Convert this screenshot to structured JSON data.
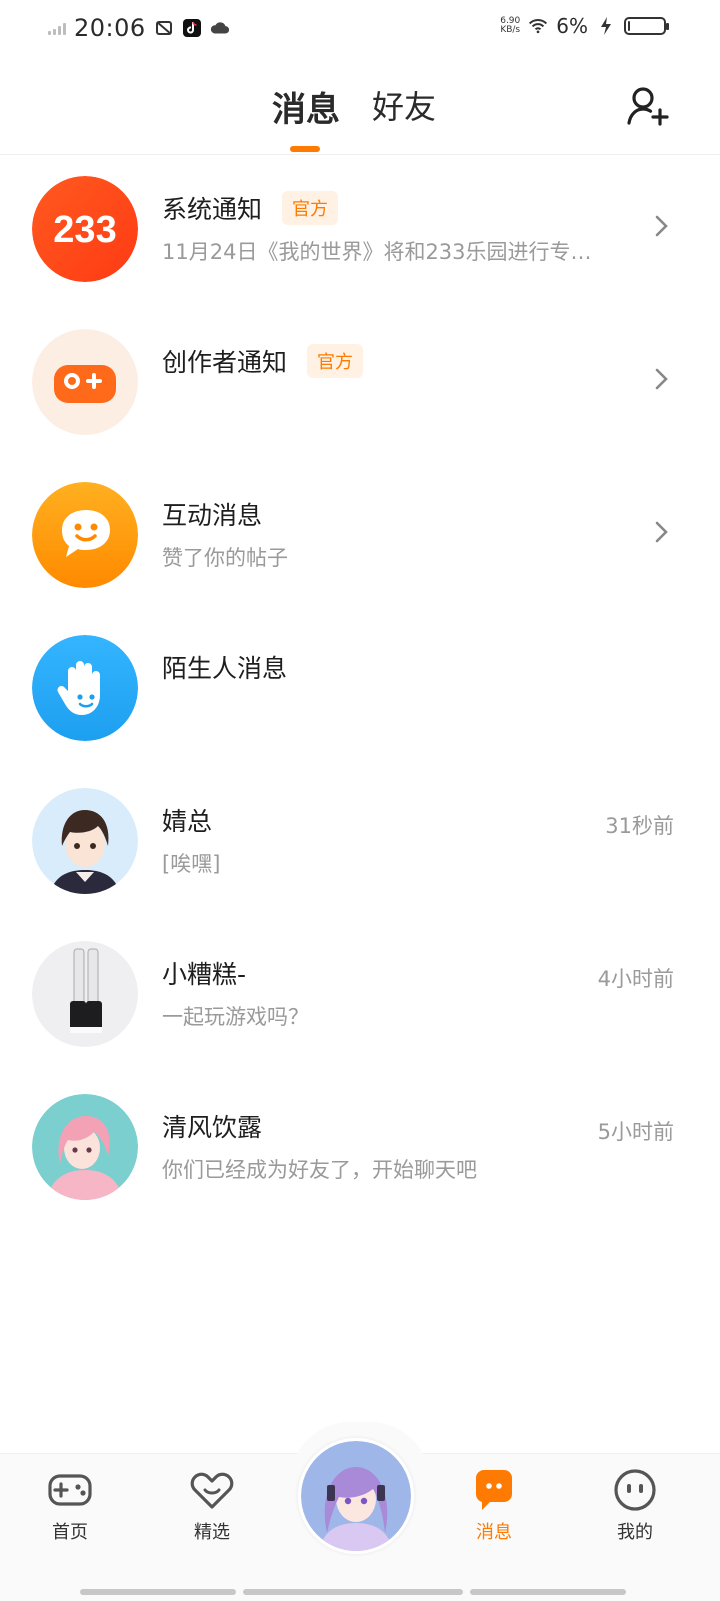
{
  "status_bar": {
    "time": "20:06",
    "net_speed_value": "6.90",
    "net_speed_unit": "KB/s",
    "battery_percent": "6%",
    "battery_level": 0.06,
    "icons": [
      "signal-icon",
      "screenshot-icon",
      "tiktok-icon",
      "cloud-icon",
      "wifi-icon",
      "charging-icon",
      "battery-icon"
    ]
  },
  "header": {
    "tabs": [
      {
        "label": "消息",
        "active": true
      },
      {
        "label": "好友",
        "active": false
      }
    ],
    "add_friend_icon": "add-user-icon"
  },
  "conversations": [
    {
      "name": "系统通知",
      "badge": "官方",
      "preview": "11月24日《我的世界》将和233乐园进行专…",
      "time": "",
      "chevron": true,
      "avatar": "233-logo"
    },
    {
      "name": "创作者通知",
      "badge": "官方",
      "preview": "",
      "time": "",
      "chevron": true,
      "avatar": "gamepad-plus-icon"
    },
    {
      "name": "互动消息",
      "badge": "",
      "preview": "赞了你的帖子",
      "time": "",
      "chevron": true,
      "avatar": "smile-bubble-icon"
    },
    {
      "name": "陌生人消息",
      "badge": "",
      "preview": "",
      "time": "",
      "chevron": false,
      "avatar": "hand-wave-icon"
    },
    {
      "name": "婧总",
      "badge": "",
      "preview": "[唉嘿]",
      "time": "31秒前",
      "chevron": false,
      "avatar": "anime-girl-avatar"
    },
    {
      "name": "小糟糕-",
      "badge": "",
      "preview": "一起玩游戏吗？",
      "time": "4小时前",
      "chevron": false,
      "avatar": "legs-avatar"
    },
    {
      "name": "清风饮露",
      "badge": "",
      "preview": "你们已经成为好友了，开始聊天吧",
      "time": "5小时前",
      "chevron": false,
      "avatar": "pink-hair-avatar"
    }
  ],
  "bottom_nav": [
    {
      "label": "首页",
      "icon": "gamepad-icon",
      "active": false
    },
    {
      "label": "精选",
      "icon": "heart-icon",
      "active": false
    },
    {
      "label": "",
      "icon": "avatar",
      "active": false
    },
    {
      "label": "消息",
      "icon": "chat-icon",
      "active": true
    },
    {
      "label": "我的",
      "icon": "face-icon",
      "active": false
    }
  ],
  "colors": {
    "accent": "#ff7a00",
    "text_primary": "#1e1e1e",
    "text_secondary": "#9a9a9a",
    "badge_bg": "#fff1e4"
  }
}
